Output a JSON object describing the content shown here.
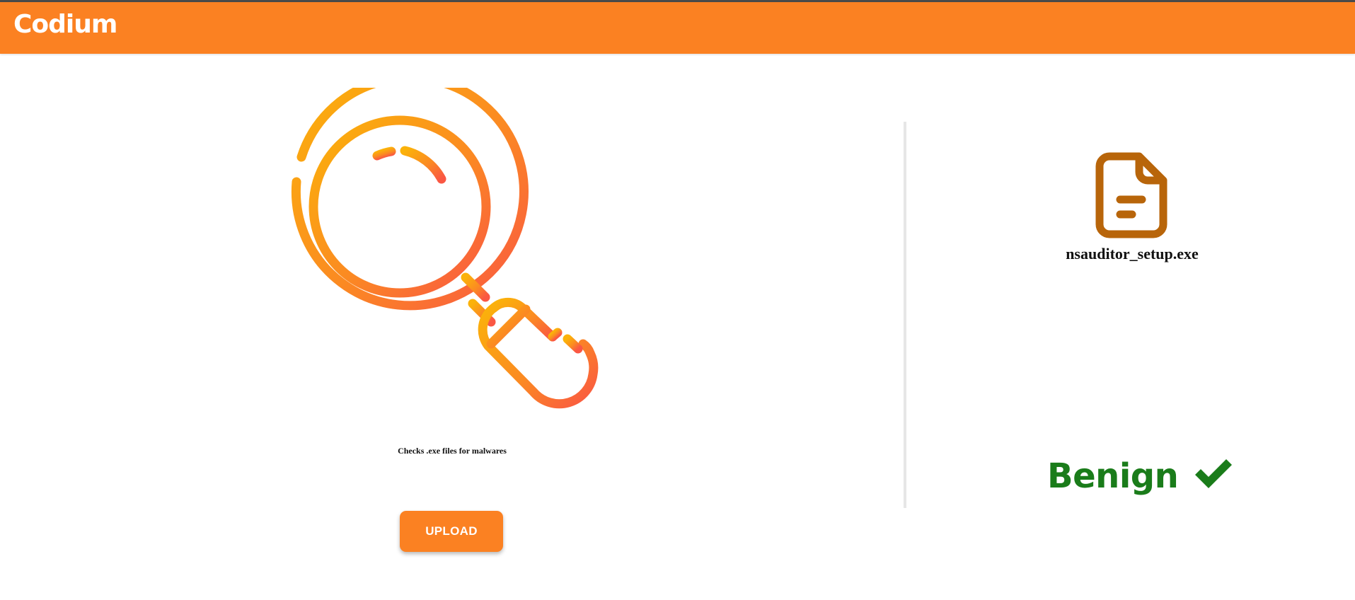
{
  "app": {
    "title": "Codium",
    "accent_color": "#fb8122"
  },
  "hero": {
    "icon": "magnifying-glass-icon",
    "tagline": "Checks .exe files for malwares"
  },
  "upload": {
    "label": "UPLOAD"
  },
  "result": {
    "file_icon": "document-icon",
    "filename": "nsauditor_setup.exe",
    "verdict": "Benign",
    "verdict_color": "#1a7c1a",
    "verdict_icon": "checkmark-icon"
  }
}
